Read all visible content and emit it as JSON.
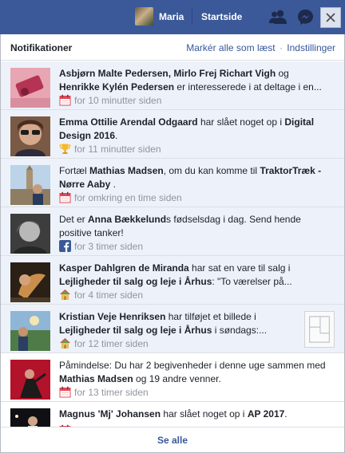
{
  "topbar": {
    "user_name": "Maria",
    "home_label": "Startside",
    "icons": [
      "friend-requests-icon",
      "messenger-icon",
      "close-icon"
    ],
    "brand_color": "#3b5998"
  },
  "notifications": {
    "title": "Notifikationer",
    "mark_all_read": "Markér alle som læst",
    "separator": "·",
    "settings": "Indstillinger",
    "see_all": "Se alle",
    "items": [
      {
        "parts": [
          {
            "t": "Asbjørn Malte Pedersen, Mirlo Frej Richart Vigh",
            "b": true
          },
          {
            "t": " og ",
            "b": false
          },
          {
            "t": "Henrikke Kylén Pedersen",
            "b": true
          },
          {
            "t": " er interesserede i at deltage i en...",
            "b": false
          }
        ],
        "icon": "calendar-icon",
        "time": "for 10 minutter siden",
        "unread": true
      },
      {
        "parts": [
          {
            "t": "Emma Ottilie Arendal Odgaard",
            "b": true
          },
          {
            "t": " har slået noget op i ",
            "b": false
          },
          {
            "t": "Digital Design 2016",
            "b": true
          },
          {
            "t": ".",
            "b": false
          }
        ],
        "icon": "trophy-icon",
        "time": "for 11 minutter siden",
        "unread": true
      },
      {
        "parts": [
          {
            "t": "Fortæl ",
            "b": false
          },
          {
            "t": "Mathias Madsen",
            "b": true
          },
          {
            "t": ", om du kan komme til ",
            "b": false
          },
          {
            "t": "TraktorTræk - Nørre Aaby",
            "b": true
          },
          {
            "t": " .",
            "b": false
          }
        ],
        "icon": "calendar-icon",
        "time": "for omkring en time siden",
        "unread": true
      },
      {
        "parts": [
          {
            "t": "Det er ",
            "b": false
          },
          {
            "t": "Anna Bækkelund",
            "b": true
          },
          {
            "t": "s fødselsdag i dag. Send hende positive tanker!",
            "b": false
          }
        ],
        "icon": "facebook-icon",
        "time": "for 3 timer siden",
        "unread": true
      },
      {
        "parts": [
          {
            "t": "Kasper Dahlgren de Miranda",
            "b": true
          },
          {
            "t": " har sat en vare til salg i ",
            "b": false
          },
          {
            "t": "Lejligheder til salg og leje i Århus",
            "b": true
          },
          {
            "t": ": \"To værelser på...",
            "b": false
          }
        ],
        "icon": "house-icon",
        "time": "for 4 timer siden",
        "unread": true
      },
      {
        "parts": [
          {
            "t": "Kristian Veje Henriksen",
            "b": true
          },
          {
            "t": " har tilføjet et billede i ",
            "b": false
          },
          {
            "t": "Lejligheder til salg og leje i Århus",
            "b": true
          },
          {
            "t": " i søndags:...",
            "b": false
          }
        ],
        "icon": "house-icon",
        "time": "for 12 timer siden",
        "unread": true
      },
      {
        "parts": [
          {
            "t": "Påmindelse: Du har 2 begivenheder i denne uge sammen med ",
            "b": false
          },
          {
            "t": "Mathias Madsen",
            "b": true
          },
          {
            "t": " og 19 andre venner.",
            "b": false
          }
        ],
        "icon": "calendar-icon",
        "time": "for 13 timer siden",
        "unread": false
      },
      {
        "parts": [
          {
            "t": "Magnus 'Mj' Johansen",
            "b": true
          },
          {
            "t": " har slået noget op i ",
            "b": false
          },
          {
            "t": "AP 2017",
            "b": true
          },
          {
            "t": ".",
            "b": false
          }
        ],
        "icon": "calendar-icon",
        "time": "",
        "unread": false
      }
    ]
  }
}
